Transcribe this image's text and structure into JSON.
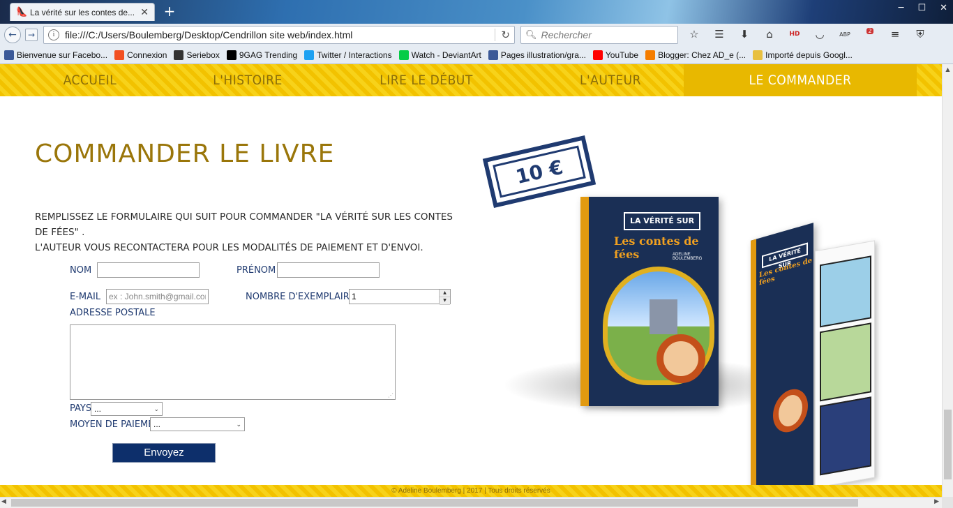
{
  "browser": {
    "tab_title": "La vérité sur les contes de...",
    "url": "file:///C:/Users/Boulemberg/Desktop/Cendrillon site web/index.html",
    "search_placeholder": "Rechercher",
    "toolbar_badges": {
      "abp": "ABP",
      "ublock": "2",
      "hd": "HD"
    },
    "bookmarks": [
      {
        "label": "Bienvenue sur Facebo...",
        "icon": "facebook-icon",
        "color": "#3b5998"
      },
      {
        "label": "Connexion",
        "icon": "windows-icon",
        "color": "#f25022"
      },
      {
        "label": "Seriebox",
        "icon": "seriebox-icon",
        "color": "#333333"
      },
      {
        "label": "9GAG Trending",
        "icon": "9gag-icon",
        "color": "#000000"
      },
      {
        "label": "Twitter / Interactions",
        "icon": "twitter-icon",
        "color": "#1da1f2"
      },
      {
        "label": "Watch - DeviantArt",
        "icon": "deviantart-icon",
        "color": "#05cc47"
      },
      {
        "label": "Pages illustration/gra...",
        "icon": "facebook-icon",
        "color": "#3b5998"
      },
      {
        "label": "YouTube",
        "icon": "youtube-icon",
        "color": "#ff0000"
      },
      {
        "label": "Blogger: Chez AD_e (...",
        "icon": "blogger-icon",
        "color": "#f57d00"
      },
      {
        "label": "Importé depuis Googl...",
        "icon": "folder-icon",
        "color": "#e8c040"
      }
    ]
  },
  "site": {
    "nav": [
      {
        "label": "Accueil",
        "active": false
      },
      {
        "label": "L'histoire",
        "active": false
      },
      {
        "label": "Lire le début",
        "active": false
      },
      {
        "label": "L'auteur",
        "active": false
      },
      {
        "label": "Le commander",
        "active": true
      }
    ],
    "title": "Commander le livre",
    "intro_line1": "Remplissez le formulaire qui suit pour commander \"La vérité sur les contes de fées\" .",
    "intro_line2": "L'auteur vous recontactera pour les modalités de paiement et d'envoi.",
    "form": {
      "nom_label": "Nom",
      "nom_value": "",
      "prenom_label": "Prénom",
      "prenom_value": "",
      "email_label": "E-mail",
      "email_placeholder": "ex : John.smith@gmail.com",
      "qty_label": "Nombre d'exemplaire(s)",
      "qty_value": "1",
      "address_label": "Adresse postale",
      "address_value": "",
      "country_label": "Pays",
      "country_value": "...",
      "payment_label": "Moyen de paiement",
      "payment_value": "...",
      "submit_label": "Envoyez"
    },
    "price_stamp": "10 €",
    "book": {
      "banner": "La vérité sur",
      "subtitle": "Les contes de fées",
      "author": "Adeline Boulemberg"
    },
    "footer": "© Adeline Boulemberg | 2017 | Tous droits réservés"
  },
  "colors": {
    "nav_yellow": "#f2c200",
    "title_gold": "#9a760a",
    "label_blue": "#1f3a70",
    "button_navy": "#0d2f6b"
  }
}
